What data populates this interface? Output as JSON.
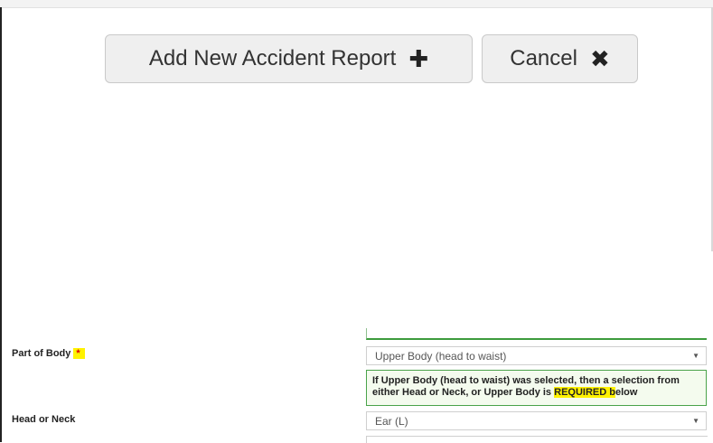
{
  "actions": {
    "add_label": "Add New Accident Report",
    "add_icon": "plus-icon",
    "cancel_label": "Cancel",
    "cancel_icon": "close-icon"
  },
  "form": {
    "part_of_body": {
      "label": "Part of Body",
      "required_marker": "*",
      "selected": "Upper Body (head to waist)"
    },
    "note": {
      "text_before": "If Upper Body (head to waist) was selected, then a selection from either Head or Neck, or Upper Body is ",
      "highlight": "REQUIRED b",
      "text_after": "elow"
    },
    "head_or_neck": {
      "label": "Head or Neck",
      "selected": "Ear (L)"
    }
  },
  "colors": {
    "required_highlight": "#fff200",
    "required_star": "#e00000",
    "note_border": "#4aa34a"
  }
}
